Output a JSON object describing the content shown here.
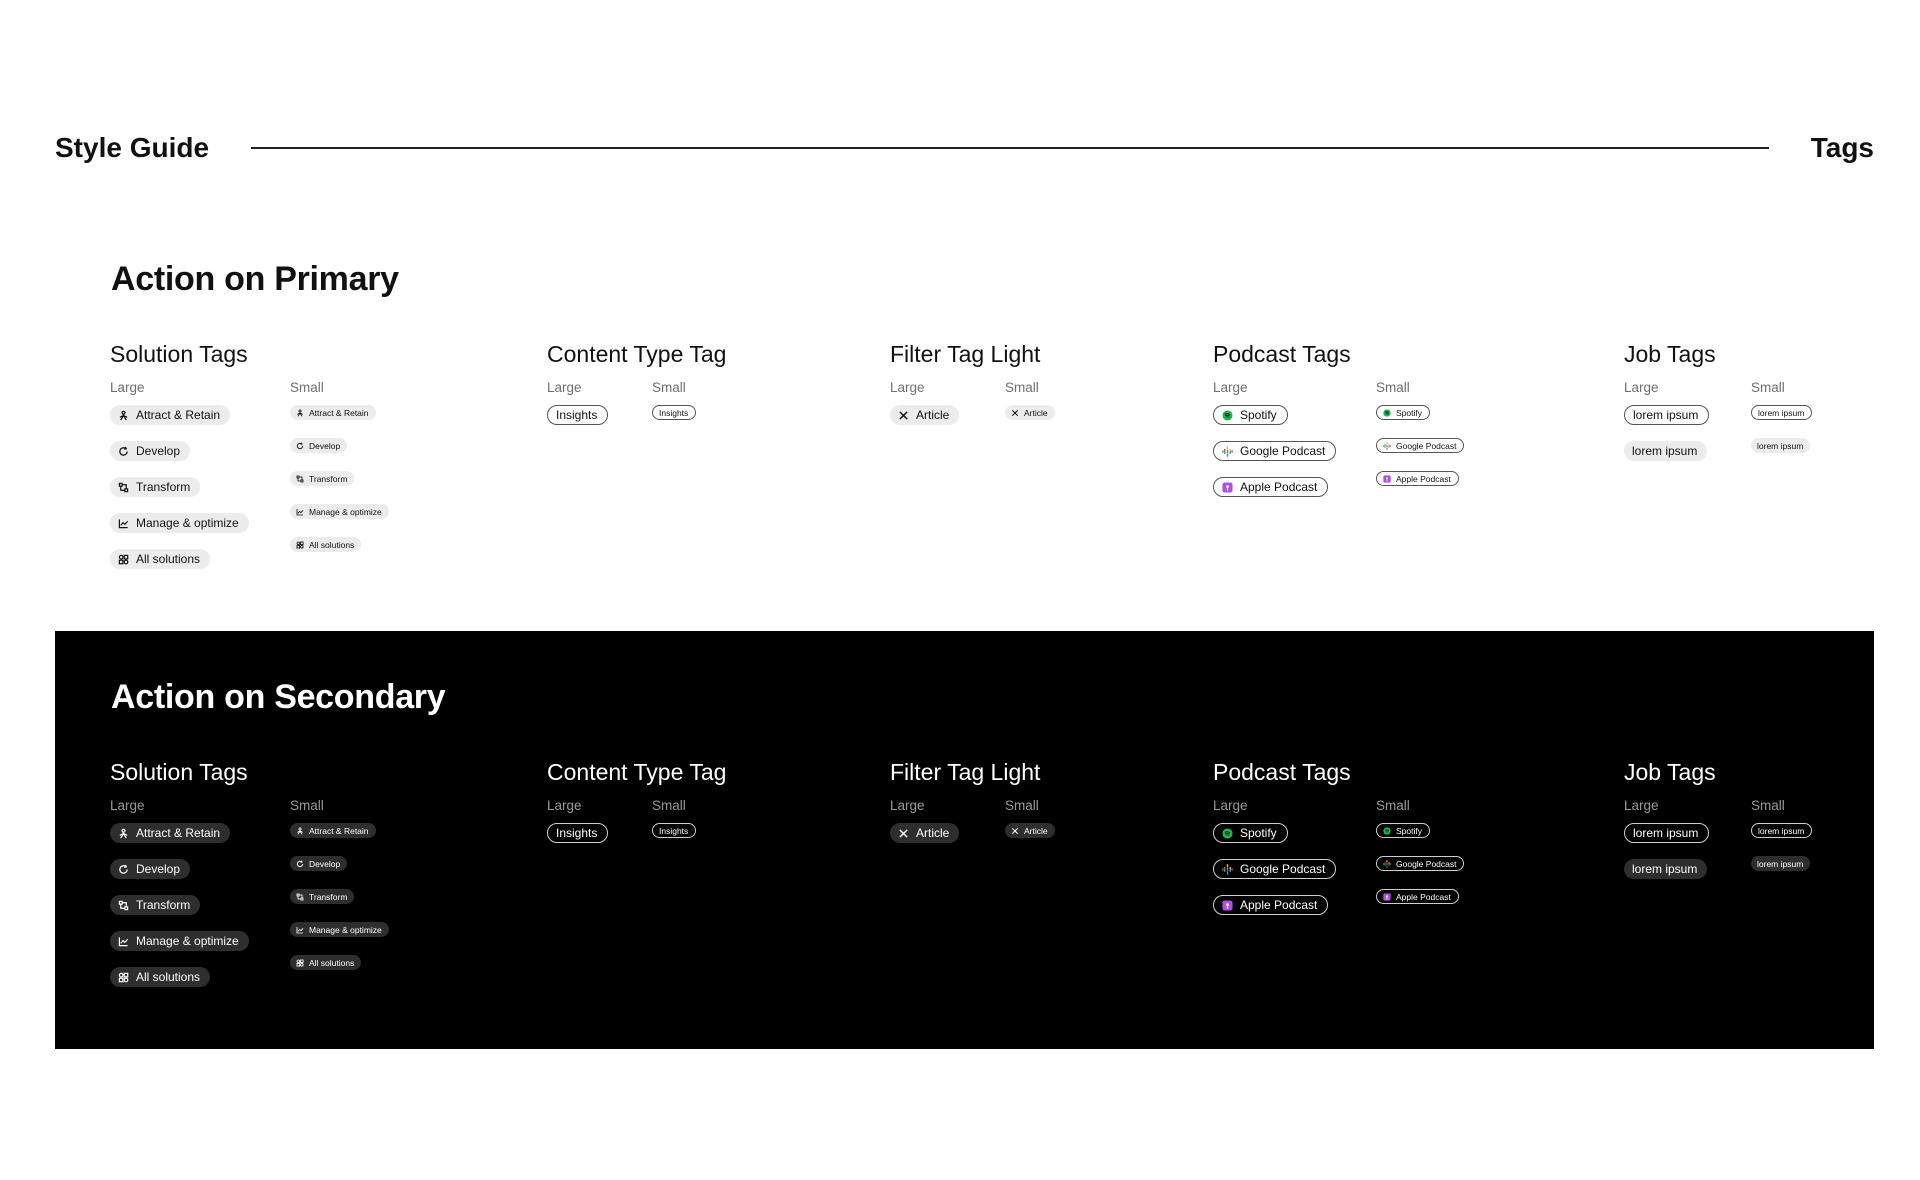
{
  "header": {
    "title": "Style Guide",
    "section": "Tags"
  },
  "primary": {
    "title": "Action on Primary",
    "solution": {
      "title": "Solution Tags",
      "large_label": "Large",
      "small_label": "Small",
      "items": [
        {
          "label": "Attract & Retain"
        },
        {
          "label": "Develop"
        },
        {
          "label": "Transform"
        },
        {
          "label": "Manage & optimize"
        },
        {
          "label": "All solutions"
        }
      ]
    },
    "content": {
      "title": "Content Type Tag",
      "large_label": "Large",
      "small_label": "Small",
      "tag": "Insights"
    },
    "filter": {
      "title": "Filter Tag Light",
      "large_label": "Large",
      "small_label": "Small",
      "tag": "Article"
    },
    "podcast": {
      "title": "Podcast Tags",
      "large_label": "Large",
      "small_label": "Small",
      "items": [
        {
          "label": "Spotify"
        },
        {
          "label": "Google Podcast"
        },
        {
          "label": "Apple Podcast"
        }
      ]
    },
    "job": {
      "title": "Job Tags",
      "large_label": "Large",
      "small_label": "Small",
      "outline_tag": "lorem ipsum",
      "fill_tag": "lorem ipsum"
    }
  },
  "secondary": {
    "title": "Action on Secondary",
    "solution": {
      "title": "Solution Tags",
      "large_label": "Large",
      "small_label": "Small",
      "items": [
        {
          "label": "Attract & Retain"
        },
        {
          "label": "Develop"
        },
        {
          "label": "Transform"
        },
        {
          "label": "Manage & optimize"
        },
        {
          "label": "All solutions"
        }
      ]
    },
    "content": {
      "title": "Content Type Tag",
      "large_label": "Large",
      "small_label": "Small",
      "tag": "Insights"
    },
    "filter": {
      "title": "Filter Tag Light",
      "large_label": "Large",
      "small_label": "Small",
      "tag": "Article"
    },
    "podcast": {
      "title": "Podcast Tags",
      "large_label": "Large",
      "small_label": "Small",
      "items": [
        {
          "label": "Spotify"
        },
        {
          "label": "Google Podcast"
        },
        {
          "label": "Apple Podcast"
        }
      ]
    },
    "job": {
      "title": "Job Tags",
      "large_label": "Large",
      "small_label": "Small",
      "outline_tag": "lorem ipsum",
      "fill_tag": "lorem ipsum"
    }
  },
  "icons": {
    "solution": [
      "attract-retain-icon",
      "develop-icon",
      "transform-icon",
      "manage-optimize-icon",
      "all-solutions-icon"
    ],
    "podcast": [
      "spotify-icon",
      "google-podcast-icon",
      "apple-podcast-icon"
    ],
    "filter": "close-icon"
  },
  "colors": {
    "secondary_bg": "#000000",
    "spotify": "#1db954",
    "apple_podcast": "#b14ee6"
  }
}
